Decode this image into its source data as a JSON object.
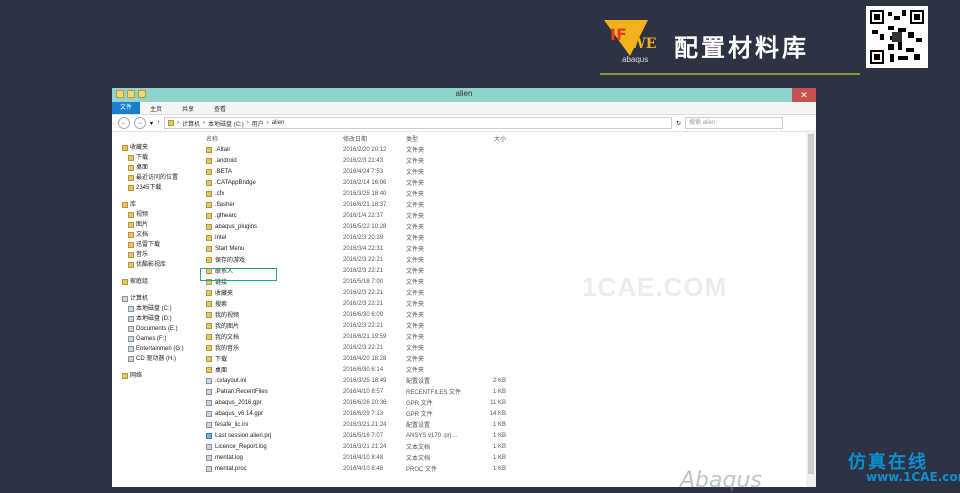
{
  "brand": {
    "title": "配置材料库",
    "sub": "abaqus"
  },
  "window": {
    "title": "alien",
    "ribbon_tabs": [
      "文件",
      "主页",
      "共享",
      "查看"
    ],
    "address": [
      "计算机",
      "本地磁盘 (C:)",
      "用户",
      "alien"
    ],
    "search_placeholder": "搜索 alien",
    "columns": {
      "name": "名称",
      "date": "修改日期",
      "type": "类型",
      "size": "大小"
    }
  },
  "nav": {
    "favorites_header": "收藏夹",
    "favorites": [
      "下载",
      "桌面",
      "最近访问的位置",
      "2345下载"
    ],
    "libraries_header": "库",
    "libraries": [
      "视频",
      "图片",
      "文档",
      "迅雷下载",
      "音乐",
      "优酷影视库"
    ],
    "homegroup": "家庭组",
    "computer_header": "计算机",
    "drives": [
      "本地磁盘 (C:)",
      "本地磁盘 (D:)",
      "Documents (E:)",
      "Games (F:)",
      "Entertainmen (G:)",
      "CD 驱动器 (H:)"
    ],
    "network": "网络"
  },
  "files": [
    {
      "name": ".Altair",
      "date": "2016/2/20 20:12",
      "type": "文件夹",
      "size": "",
      "icon": "folder"
    },
    {
      "name": ".android",
      "date": "2016/2/3 21:43",
      "type": "文件夹",
      "size": "",
      "icon": "folder"
    },
    {
      "name": ".BETA",
      "date": "2016/4/24 7:53",
      "type": "文件夹",
      "size": "",
      "icon": "folder"
    },
    {
      "name": ".CATAppBridge",
      "date": "2016/2/14 16:06",
      "type": "文件夹",
      "size": "",
      "icon": "folder"
    },
    {
      "name": ".cfx",
      "date": "2016/3/25 18:40",
      "type": "文件夹",
      "size": "",
      "icon": "folder"
    },
    {
      "name": ".flasher",
      "date": "2016/6/21 18:37",
      "type": "文件夹",
      "size": "",
      "icon": "folder"
    },
    {
      "name": ".gthearc",
      "date": "2016/1/4 22:37",
      "type": "文件夹",
      "size": "",
      "icon": "folder"
    },
    {
      "name": "abaqus_plugins",
      "date": "2016/5/22 10:28",
      "type": "文件夹",
      "size": "",
      "icon": "folder"
    },
    {
      "name": "Intel",
      "date": "2016/2/3 20:39",
      "type": "文件夹",
      "size": "",
      "icon": "folder"
    },
    {
      "name": "Start Menu",
      "date": "2016/3/4 22:31",
      "type": "文件夹",
      "size": "",
      "icon": "folder"
    },
    {
      "name": "保存的游戏",
      "date": "2016/2/3 22:21",
      "type": "文件夹",
      "size": "",
      "icon": "folder"
    },
    {
      "name": "联系人",
      "date": "2016/2/3 22:21",
      "type": "文件夹",
      "size": "",
      "icon": "folder"
    },
    {
      "name": "链接",
      "date": "2016/5/18 7:00",
      "type": "文件夹",
      "size": "",
      "icon": "folder"
    },
    {
      "name": "收藏夹",
      "date": "2016/2/3 22:21",
      "type": "文件夹",
      "size": "",
      "icon": "folder"
    },
    {
      "name": "搜索",
      "date": "2016/2/3 22:21",
      "type": "文件夹",
      "size": "",
      "icon": "folder"
    },
    {
      "name": "我的视频",
      "date": "2016/6/30 6:09",
      "type": "文件夹",
      "size": "",
      "icon": "folder"
    },
    {
      "name": "我的图片",
      "date": "2016/2/3 22:21",
      "type": "文件夹",
      "size": "",
      "icon": "folder"
    },
    {
      "name": "我的文档",
      "date": "2016/6/21 19:59",
      "type": "文件夹",
      "size": "",
      "icon": "folder"
    },
    {
      "name": "我的音乐",
      "date": "2016/2/3 22:21",
      "type": "文件夹",
      "size": "",
      "icon": "folder"
    },
    {
      "name": "下载",
      "date": "2016/4/20 18:28",
      "type": "文件夹",
      "size": "",
      "icon": "folder"
    },
    {
      "name": "桌面",
      "date": "2016/6/30 6:14",
      "type": "文件夹",
      "size": "",
      "icon": "folder"
    },
    {
      "name": ".cxlayout.ini",
      "date": "2016/3/25 18:49",
      "type": "配置设置",
      "size": "2 KB",
      "icon": "file"
    },
    {
      "name": ".Patran.RecentFiles",
      "date": "2016/4/10 8:57",
      "type": "RECENTFILES 文件",
      "size": "1 KB",
      "icon": "file"
    },
    {
      "name": "abaqus_2016.gpr",
      "date": "2016/6/26 20:36",
      "type": "GPR 文件",
      "size": "11 KB",
      "icon": "file"
    },
    {
      "name": "abaqus_v6.14.gpr",
      "date": "2016/6/29 7:13",
      "type": "GPR 文件",
      "size": "14 KB",
      "icon": "file"
    },
    {
      "name": "fesafe_lic.ini",
      "date": "2016/3/21 21:24",
      "type": "配置设置",
      "size": "1 KB",
      "icon": "file"
    },
    {
      "name": "Last session alien.prj",
      "date": "2016/5/16 7:07",
      "type": "ANSYS v170 .prj ...",
      "size": "1 KB",
      "icon": "file-blue"
    },
    {
      "name": "Licence_Report.log",
      "date": "2016/3/21 21:24",
      "type": "文本文档",
      "size": "1 KB",
      "icon": "file"
    },
    {
      "name": "mentat.log",
      "date": "2016/4/10 8:48",
      "type": "文本文档",
      "size": "1 KB",
      "icon": "file"
    },
    {
      "name": "mentat.proc",
      "date": "2016/4/10 8:48",
      "type": "PROC 文件",
      "size": "1 KB",
      "icon": "file"
    }
  ],
  "watermarks": {
    "center": "1CAE.COM",
    "corner_line1": "仿真在线",
    "corner_line2": "www.1CAE.com",
    "bottom": "Abaqus"
  }
}
